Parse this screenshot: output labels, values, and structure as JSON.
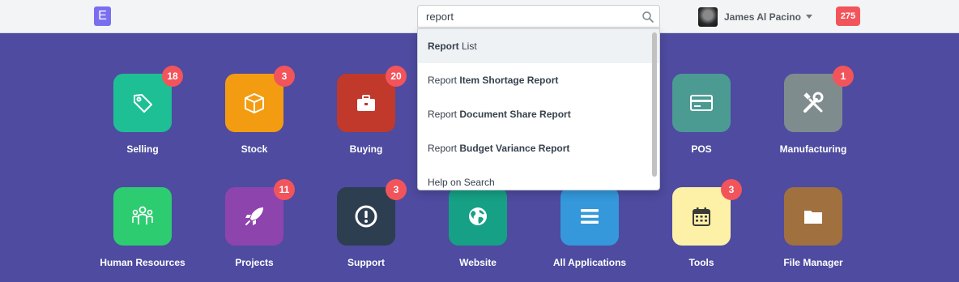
{
  "navbar": {
    "logo_letter": "E",
    "search_value": "report",
    "user_name": "James Al Pacino",
    "notification_count": "275"
  },
  "apps": [
    {
      "label": "Selling",
      "badge": "18",
      "color": "#1fbf95",
      "icon": "tag-icon"
    },
    {
      "label": "Stock",
      "badge": "3",
      "color": "#f39c12",
      "icon": "box-icon"
    },
    {
      "label": "Buying",
      "badge": "20",
      "color": "#c0392b",
      "icon": "briefcase-icon"
    },
    {
      "label": "POS",
      "badge": "",
      "color": "#4b9b92",
      "icon": "card-icon"
    },
    {
      "label": "Manufacturing",
      "badge": "1",
      "color": "#7f8c8d",
      "icon": "tools-icon"
    },
    {
      "label": "Human Resources",
      "badge": "",
      "color": "#2ecc71",
      "icon": "people-icon"
    },
    {
      "label": "Projects",
      "badge": "11",
      "color": "#8e44ad",
      "icon": "rocket-icon"
    },
    {
      "label": "Support",
      "badge": "3",
      "color": "#2c3e50",
      "icon": "alert-icon"
    },
    {
      "label": "Website",
      "badge": "",
      "color": "#16a085",
      "icon": "globe-icon"
    },
    {
      "label": "All Applications",
      "badge": "",
      "color": "#3498db",
      "icon": "list-icon"
    },
    {
      "label": "Tools",
      "badge": "3",
      "color": "#fdf1a7",
      "icon": "calendar-icon"
    },
    {
      "label": "File Manager",
      "badge": "",
      "color": "#a0703f",
      "icon": "folder-icon"
    }
  ],
  "search_results": [
    {
      "prefix": "",
      "bold": "Report",
      "suffix": " List"
    },
    {
      "prefix": "Report ",
      "bold": "Item Shortage Report",
      "suffix": ""
    },
    {
      "prefix": "Report ",
      "bold": "Document Share Report",
      "suffix": ""
    },
    {
      "prefix": "Report ",
      "bold": "Budget Variance Report",
      "suffix": ""
    },
    {
      "prefix": "Help on Search",
      "bold": "",
      "suffix": ""
    }
  ]
}
